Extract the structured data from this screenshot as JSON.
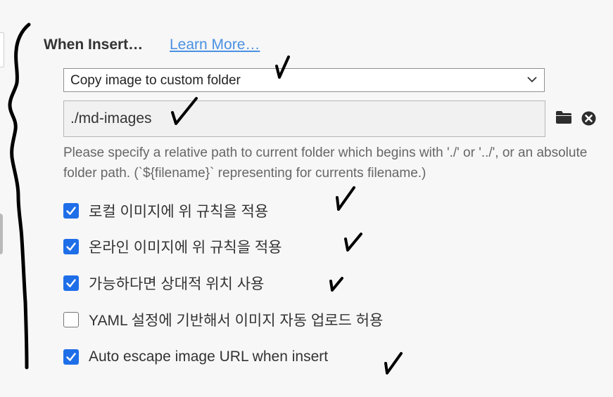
{
  "section": {
    "title": "When Insert…",
    "learn_more": "Learn More…"
  },
  "action_select": {
    "value": "Copy image to custom folder"
  },
  "path_field": {
    "value": "./md-images"
  },
  "icons": {
    "folder": "folder-icon",
    "clear": "close-circle-icon",
    "dropdown": "chevron-down-icon",
    "check": "checkmark-icon"
  },
  "hint": "Please specify a relative path to current folder which begins with './' or '../', or an absolute folder path. (`${filename}` representing for currents filename.)",
  "options": [
    {
      "label": "로컬 이미지에 위 규칙을 적용",
      "checked": true
    },
    {
      "label": "온라인 이미지에 위 규칙을 적용",
      "checked": true
    },
    {
      "label": "가능하다면 상대적 위치 사용",
      "checked": true
    },
    {
      "label": "YAML 설정에 기반해서 이미지 자동 업로드 허용",
      "checked": false
    },
    {
      "label": "Auto escape image URL when insert",
      "checked": true
    }
  ],
  "colors": {
    "accent": "#1e6ee8",
    "link": "#4a90e2",
    "annotation_ink": "#000000"
  }
}
